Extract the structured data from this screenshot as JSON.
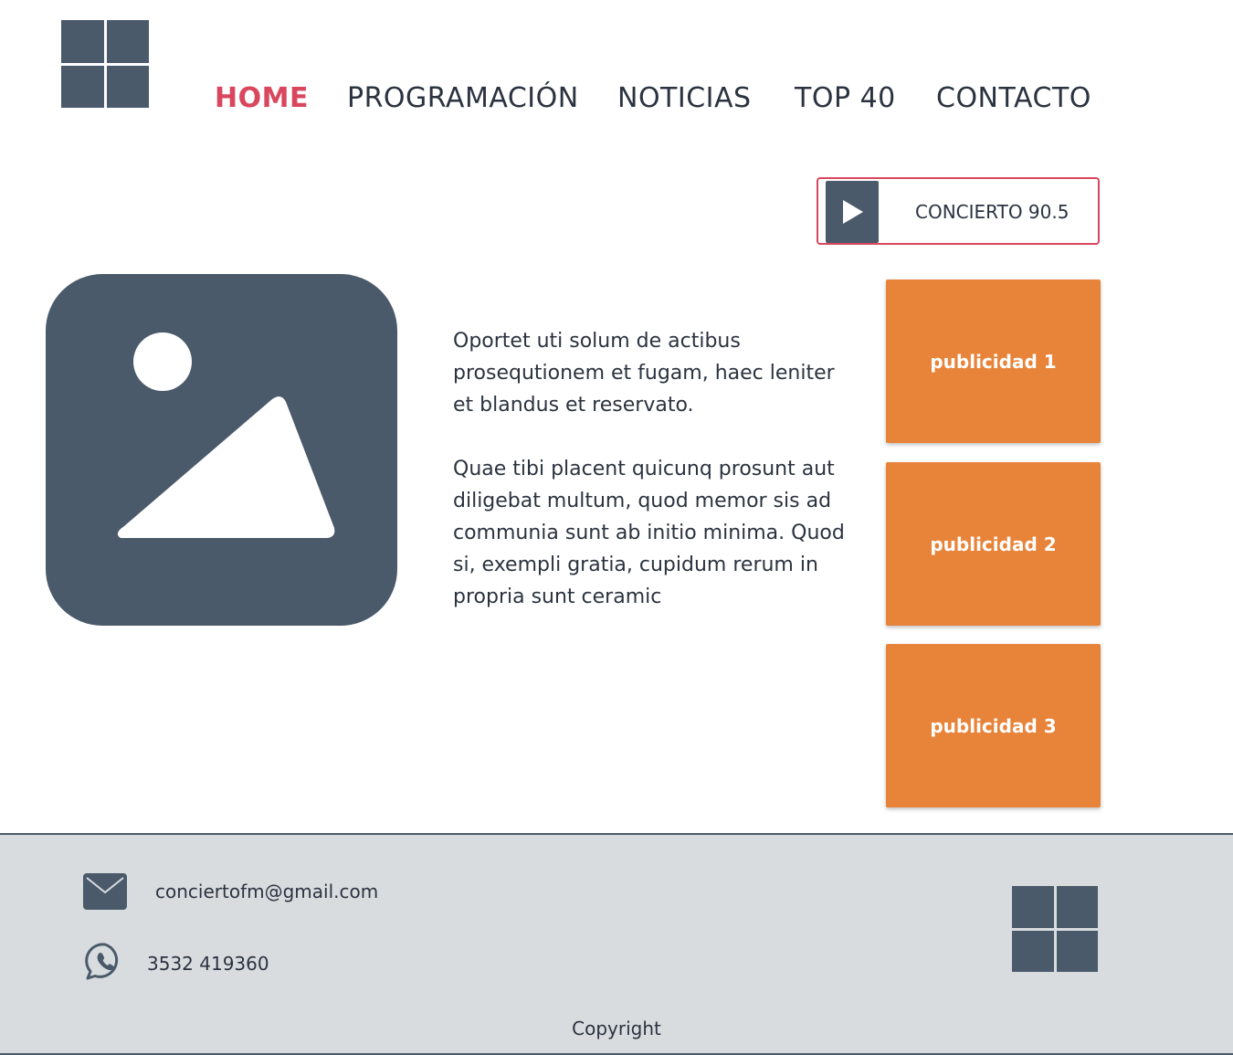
{
  "brand": {
    "logo_icon": "grid-logo-icon"
  },
  "nav": {
    "items": [
      {
        "label": "HOME",
        "active": true
      },
      {
        "label": "PROGRAMACIÓN",
        "active": false
      },
      {
        "label": "NOTICIAS",
        "active": false
      },
      {
        "label": "TOP 40",
        "active": false
      },
      {
        "label": "CONTACTO",
        "active": false
      }
    ]
  },
  "player": {
    "station_label": "CONCIERTO 90.5",
    "play_icon": "play-icon"
  },
  "main": {
    "image_icon": "image-placeholder-icon",
    "paragraphs": [
      "Oportet uti solum de actibus prosequtionem et fugam, haec leniter et blandus et reservato.",
      "Quae tibi placent quicunq prosunt aut diligebat multum, quod memor sis ad communia sunt ab initio minima. Quod si, exempli gratia, cupidum rerum in propria sunt ceramic"
    ]
  },
  "ads": [
    {
      "label": "publicidad 1"
    },
    {
      "label": "publicidad 2"
    },
    {
      "label": "publicidad 3"
    }
  ],
  "footer": {
    "email": "conciertofm@gmail.com",
    "email_icon": "mail-icon",
    "phone": "3532 419360",
    "phone_icon": "whatsapp-icon",
    "copyright": "Copyright"
  },
  "colors": {
    "accent": "#d9475e",
    "primary": "#4a5a6a",
    "ad_orange": "#e8843a",
    "footer_bg": "#d9dcdf"
  }
}
